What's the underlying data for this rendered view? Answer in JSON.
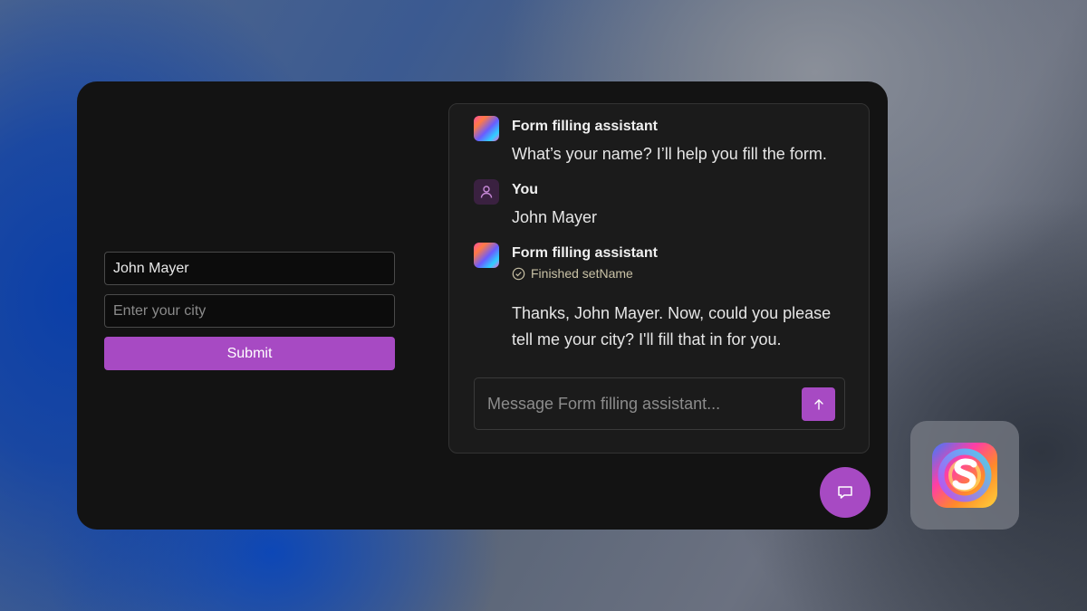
{
  "form": {
    "name_value": "John Mayer",
    "city_placeholder": "Enter your city",
    "submit_label": "Submit"
  },
  "chat": {
    "messages": [
      {
        "sender": "Form filling assistant",
        "avatar": "gradient-logo-icon",
        "text": "What’s your name? I’ll help you fill the form."
      },
      {
        "sender": "You",
        "avatar": "user-icon",
        "text": "John Mayer"
      },
      {
        "sender": "Form filling assistant",
        "avatar": "gradient-logo-icon",
        "status": "Finished setName",
        "status_icon": "check-circle-icon",
        "text": "Thanks, John Mayer. Now, could you please tell me your city? I'll fill that in for you."
      }
    ],
    "composer_placeholder": "Message Form filling assistant...",
    "send_icon": "arrow-up-icon"
  },
  "fab_icon": "chat-bubble-icon",
  "app_icon": "swirl-s-logo-icon",
  "colors": {
    "accent": "#a74ac3",
    "card_bg": "#131313",
    "chat_bg": "#1b1b1b"
  }
}
